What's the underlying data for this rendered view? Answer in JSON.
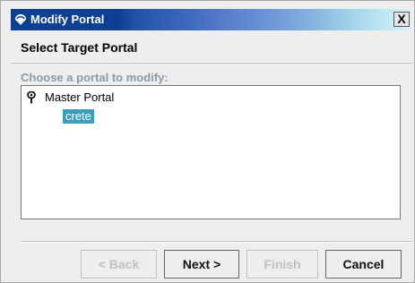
{
  "window": {
    "title": "Modify Portal",
    "close_label": "X"
  },
  "heading": "Select Target Portal",
  "prompt": "Choose a portal to modify:",
  "tree": {
    "root": {
      "label": "Master Portal",
      "icon": "pin-icon"
    },
    "children": [
      {
        "label": "crete",
        "selected": true
      }
    ]
  },
  "buttons": {
    "back": {
      "label": "< Back",
      "enabled": false
    },
    "next": {
      "label": "Next >",
      "enabled": true
    },
    "finish": {
      "label": "Finish",
      "enabled": false
    },
    "cancel": {
      "label": "Cancel",
      "enabled": true
    }
  },
  "colors": {
    "title_bar": "#0d3f93",
    "selection": "#3a9fbf",
    "prompt_text": "#8c9aa8"
  }
}
